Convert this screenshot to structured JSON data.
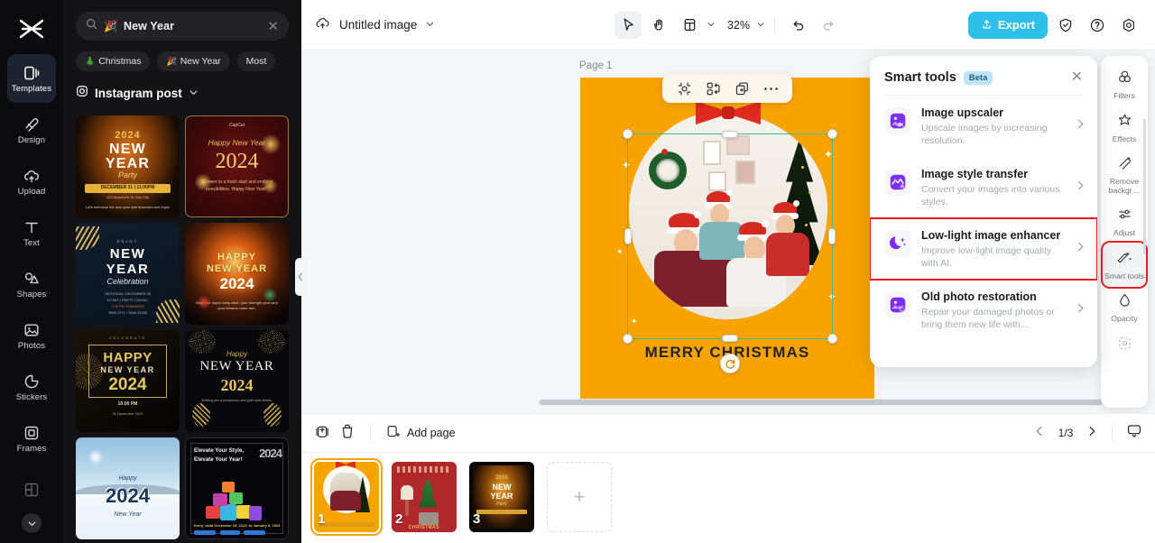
{
  "app": {
    "logo_icon": "capcut-logo-icon"
  },
  "rail": {
    "items": [
      {
        "label": "Templates",
        "icon": "templates-icon",
        "active": true
      },
      {
        "label": "Design",
        "icon": "design-icon",
        "active": false
      },
      {
        "label": "Upload",
        "icon": "upload-cloud-icon",
        "active": false
      },
      {
        "label": "Text",
        "icon": "text-icon",
        "active": false
      },
      {
        "label": "Shapes",
        "icon": "shapes-icon",
        "active": false
      },
      {
        "label": "Photos",
        "icon": "photos-icon",
        "active": false
      },
      {
        "label": "Stickers",
        "icon": "stickers-icon",
        "active": false
      },
      {
        "label": "Frames",
        "icon": "frames-icon",
        "active": false
      },
      {
        "label": "",
        "icon": "grid-icon",
        "active": false
      }
    ],
    "more_icon": "chevron-down-icon"
  },
  "panel": {
    "search": {
      "value": "New Year",
      "emoji": "🎉",
      "search_icon": "search-icon",
      "clear_icon": "close-icon"
    },
    "tags": [
      {
        "label": "Christmas",
        "emoji": "🎄"
      },
      {
        "label": "New Year",
        "emoji": "🎉"
      },
      {
        "label": "Most",
        "emoji": ""
      }
    ],
    "category": {
      "label": "Instagram post",
      "icon": "instagram-icon",
      "chevron": "chevron-down-icon"
    },
    "templates": [
      {
        "id": "t1",
        "title_lines": [
          "2024",
          "NEW",
          "YEAR",
          "Party"
        ],
        "sub": "DECEMBER 31 | 11:00PM",
        "sub2": "123 Anywhere St. Any City",
        "footer": "Let's welcome the new year with fireworks and hope!"
      },
      {
        "id": "t2",
        "title_lines": [
          "Happy New Year",
          "2024"
        ],
        "sub": "\"Cheers to a fresh start and endless possibilities. Happy New Year!\"",
        "brand": "CapCut"
      },
      {
        "id": "t3",
        "title_lines": [
          "NEW",
          "YEAR",
          "Celebration"
        ],
        "sub": "SATURDAY, DECEMBER 30",
        "sub2": "DJ MIX  |  PARTY  |  MUSIC",
        "sub3": "7:00 PM ONWARDS",
        "sub4": "7868 1771 / 7868 31405"
      },
      {
        "id": "t4",
        "title_lines": [
          "HAPPY",
          "NEW YEAR",
          "2024"
        ],
        "sub": "May your hopes keep alive, your strength grow and your dreams come true."
      },
      {
        "id": "t5",
        "title_lines": [
          "HAPPY",
          "NEW YEAR",
          "2024"
        ],
        "sub": "10:00 PM",
        "sub2": "31 December 2023"
      },
      {
        "id": "t6",
        "title_lines": [
          "Happy",
          "NEW YEAR",
          "2024"
        ],
        "sub": "Wishing you a prosperous and joyful year ahead."
      },
      {
        "id": "t7",
        "title_lines": [
          "Happy",
          "2024",
          "New Year"
        ],
        "sub": ""
      },
      {
        "id": "t8",
        "title_lines": [
          "Elevate Your Style,",
          "Elevate Your Year!",
          "2024"
        ],
        "sub": "Hurry, valid December 25, 2023, to January 5, 2024"
      }
    ]
  },
  "topbar": {
    "cloud_icon": "cloud-sync-icon",
    "doc_title": "Untitled image",
    "doc_chevron": "chevron-down-icon",
    "tools": [
      {
        "name": "select-tool",
        "icon": "cursor-icon",
        "selected": true
      },
      {
        "name": "hand-tool",
        "icon": "hand-icon",
        "selected": false
      },
      {
        "name": "layout-tool",
        "icon": "layout-icon",
        "selected": false
      }
    ],
    "zoom_level": "32%",
    "zoom_chevron": "chevron-down-icon",
    "undo_icon": "undo-icon",
    "redo_icon": "redo-icon",
    "export_label": "Export",
    "export_icon": "upload-icon",
    "export_color": "#2ec0e8",
    "right_icons": [
      {
        "name": "shield-check-icon"
      },
      {
        "name": "help-circle-icon"
      },
      {
        "name": "settings-icon"
      }
    ]
  },
  "canvas": {
    "page_label": "Page 1",
    "page_tool_icons": [
      "duplicate-page-icon",
      "more-options-icon"
    ],
    "background_color": "#f7a400",
    "artwork_text": "MERRY CHRISTMAS",
    "float_toolbar": [
      {
        "name": "crop-icon"
      },
      {
        "name": "replace-icon"
      },
      {
        "name": "duplicate-icon"
      },
      {
        "name": "more-options-icon"
      }
    ],
    "rotate_icon": "rotate-icon",
    "selection_color": "#3bbd8f"
  },
  "smart_tools": {
    "title": "Smart tools",
    "badge": "Beta",
    "close_icon": "close-icon",
    "items": [
      {
        "name": "Image upscaler",
        "desc": "Upscale images by increasing resolution.",
        "icon": "image-4k-icon",
        "highlighted": false
      },
      {
        "name": "Image style transfer",
        "desc": "Convert your images into various styles.",
        "icon": "image-style-icon",
        "highlighted": false
      },
      {
        "name": "Low-light image enhancer",
        "desc": "Improve low-light image quality with AI.",
        "icon": "moon-sparkle-icon",
        "highlighted": true
      },
      {
        "name": "Old photo restoration",
        "desc": "Repair your damaged photos or bring them new life with…",
        "icon": "image-restore-icon",
        "highlighted": false
      }
    ],
    "highlight_color": "#ec1c24"
  },
  "right_rail": {
    "items": [
      {
        "label": "Filters",
        "icon": "filters-icon",
        "selected": false
      },
      {
        "label": "Effects",
        "icon": "effects-icon",
        "selected": false
      },
      {
        "label": "Remove backgr…",
        "icon": "remove-background-icon",
        "selected": false
      },
      {
        "label": "Adjust",
        "icon": "adjust-icon",
        "selected": false
      },
      {
        "label": "Smart tools",
        "icon": "magic-wand-icon",
        "selected": true
      },
      {
        "label": "Opacity",
        "icon": "opacity-icon",
        "selected": false
      },
      {
        "label": "",
        "icon": "crop-icon",
        "selected": false
      }
    ]
  },
  "bottom": {
    "tools": [
      {
        "name": "duplicate-page-icon"
      },
      {
        "name": "delete-page-icon"
      }
    ],
    "add_page_label": "Add page",
    "add_page_icon": "add-page-icon",
    "prev_icon": "chevron-left-icon",
    "next_icon": "chevron-right-icon",
    "page_indicator": "1/3",
    "present_icon": "present-icon",
    "thumbnails": [
      {
        "number": "1",
        "caption": "MERRY CHRISTMAS",
        "selected": true
      },
      {
        "number": "2",
        "caption": "CHRISTMAS",
        "selected": false
      },
      {
        "number": "3",
        "caption": "2024 NEW YEAR Party",
        "selected": false
      }
    ],
    "add_thumb_icon": "plus-icon"
  }
}
